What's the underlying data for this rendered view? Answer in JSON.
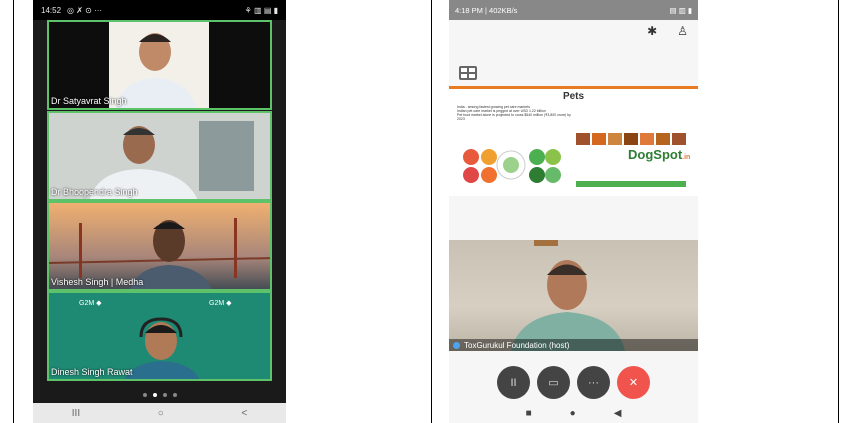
{
  "left_phone": {
    "status_time": "14:52",
    "status_left_icons": "◎ ✗ ⊙ ···",
    "status_right_icons": "⚘ ▥ ▤ ▮",
    "tiles": [
      {
        "name": "Dr Satyavrat Singh"
      },
      {
        "name": "Dr Bhoopendra Singh"
      },
      {
        "name": "Vishesh Singh | Medha"
      },
      {
        "name": "Dinesh Singh Rawat"
      }
    ],
    "nav_buttons": [
      "III",
      "○",
      "<"
    ]
  },
  "right_phone": {
    "status_text": "4:18 PM | 402KB/s",
    "status_right_icons": "▤ ▥ ▮",
    "slide": {
      "title": "Pets",
      "bullets": [
        "India - among fastest growing pet care markets",
        "Indian pet care market is pegged at over USD 1.22 billion",
        "Pet food market alone is projected to cross $540 million (₹3,800 crore) by 2023"
      ],
      "brand": "DogSpot",
      "brand_suffix": ".in"
    },
    "host_label": "ToxGurukul Foundation (host)",
    "controls": [
      {
        "name": "pause",
        "glyph": "II"
      },
      {
        "name": "video-off",
        "glyph": "▭"
      },
      {
        "name": "more",
        "glyph": "···"
      },
      {
        "name": "end-call",
        "glyph": "✕"
      }
    ],
    "nav_buttons": [
      "■",
      "●",
      "◀"
    ]
  }
}
